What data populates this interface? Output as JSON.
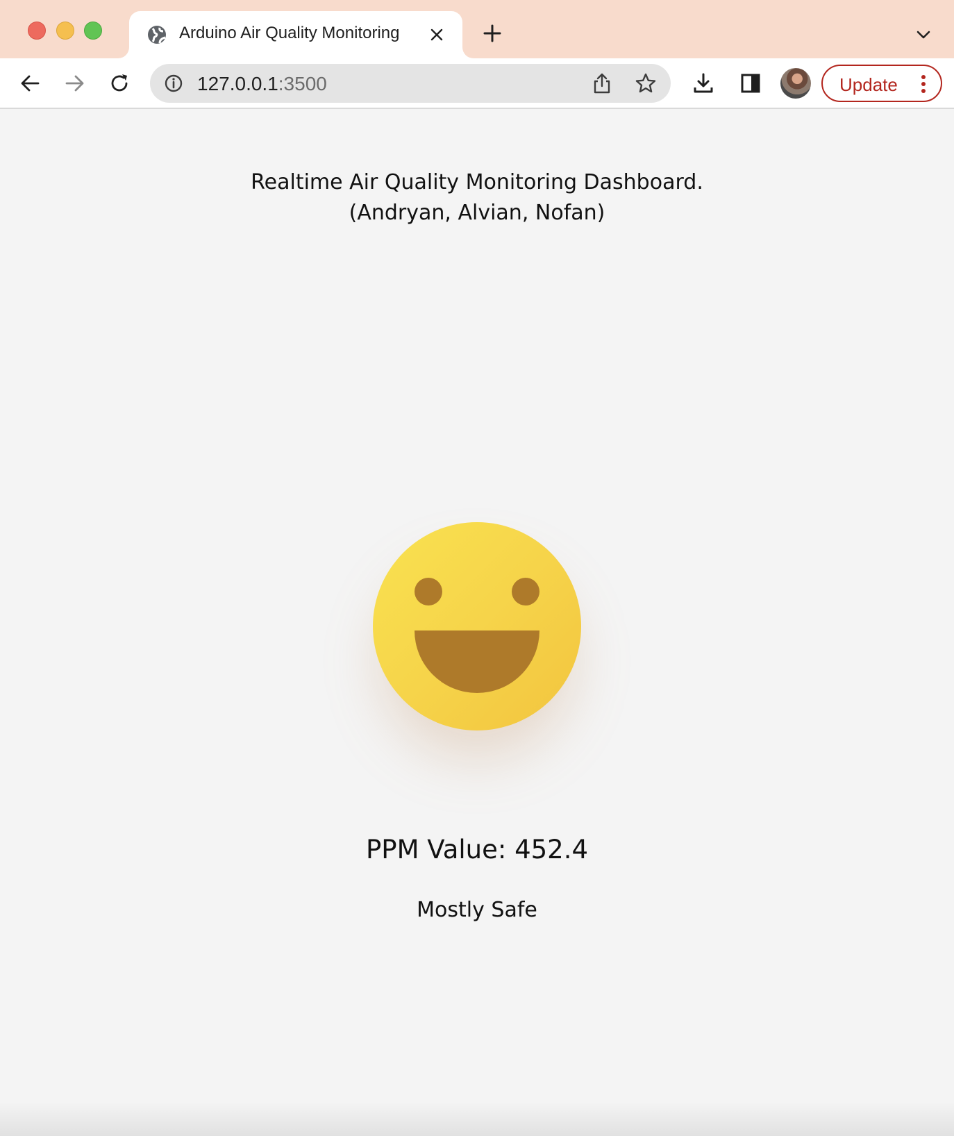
{
  "browser": {
    "tab": {
      "title": "Arduino Air Quality Monitoring",
      "favicon": "globe-icon"
    },
    "address_bar": {
      "host": "127.0.0.1",
      "port": ":3500"
    },
    "update_button": {
      "label": "Update",
      "color": "#b3261e"
    },
    "tab_strip_color": "#f8dbcc"
  },
  "page": {
    "heading_line1": "Realtime Air Quality Monitoring Dashboard.",
    "heading_line2": "(Andryan, Alvian, Nofan)",
    "indicator": {
      "icon": "happy-face-icon",
      "face_color": "#f6d44a",
      "feature_color": "#ae7a2a"
    },
    "ppm_text": "PPM Value: 452.4",
    "status_text": "Mostly Safe",
    "background": "#f4f4f4"
  }
}
